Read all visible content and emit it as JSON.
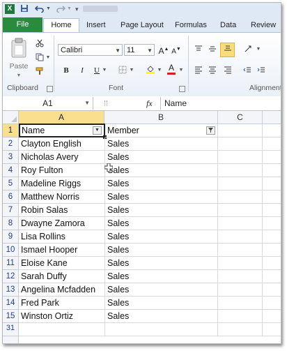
{
  "app": {
    "logo_letter": "X"
  },
  "qat": {
    "save_icon": "save-icon",
    "undo_icon": "undo-icon",
    "redo_icon": "redo-icon"
  },
  "tabs": [
    {
      "label": "File"
    },
    {
      "label": "Home"
    },
    {
      "label": "Insert"
    },
    {
      "label": "Page Layout"
    },
    {
      "label": "Formulas"
    },
    {
      "label": "Data"
    },
    {
      "label": "Review"
    }
  ],
  "ribbon": {
    "clipboard": {
      "paste_label": "Paste",
      "group_label": "Clipboard"
    },
    "font": {
      "font_name": "Calibri",
      "font_size": "11",
      "group_label": "Font",
      "bold": "B",
      "italic": "I",
      "underline": "U",
      "grow": "A",
      "shrink": "A",
      "font_color_letter": "A"
    },
    "alignment": {
      "group_label": "Alignment"
    }
  },
  "formula_bar": {
    "name_box": "A1",
    "fx_label": "fx",
    "value": "Name"
  },
  "columns": [
    "A",
    "B",
    "C"
  ],
  "header_row": {
    "row_number": "1",
    "a": "Name",
    "b": "Member"
  },
  "rows": [
    {
      "num": "2",
      "a": "Clayton English",
      "b": "Sales"
    },
    {
      "num": "3",
      "a": "Nicholas Avery",
      "b": "Sales"
    },
    {
      "num": "4",
      "a": "Roy Fulton",
      "b": "Sales"
    },
    {
      "num": "5",
      "a": "Madeline Riggs",
      "b": "Sales"
    },
    {
      "num": "6",
      "a": "Matthew Norris",
      "b": "Sales"
    },
    {
      "num": "7",
      "a": "Robin Salas",
      "b": "Sales"
    },
    {
      "num": "8",
      "a": "Dwayne Zamora",
      "b": "Sales"
    },
    {
      "num": "9",
      "a": "Lisa Rollins",
      "b": "Sales"
    },
    {
      "num": "10",
      "a": "Ismael Hooper",
      "b": "Sales"
    },
    {
      "num": "11",
      "a": "Eloise Kane",
      "b": "Sales"
    },
    {
      "num": "12",
      "a": "Sarah Duffy",
      "b": "Sales"
    },
    {
      "num": "13",
      "a": "Angelina Mcfadden",
      "b": "Sales"
    },
    {
      "num": "14",
      "a": "Fred Park",
      "b": "Sales"
    },
    {
      "num": "15",
      "a": "Winston Ortiz",
      "b": "Sales"
    }
  ],
  "last_row": {
    "num": "31"
  },
  "colors": {
    "file_tab": "#2a8a3e",
    "selected_header": "#f9df8e",
    "ribbon_bg": "#dfe8f5"
  }
}
